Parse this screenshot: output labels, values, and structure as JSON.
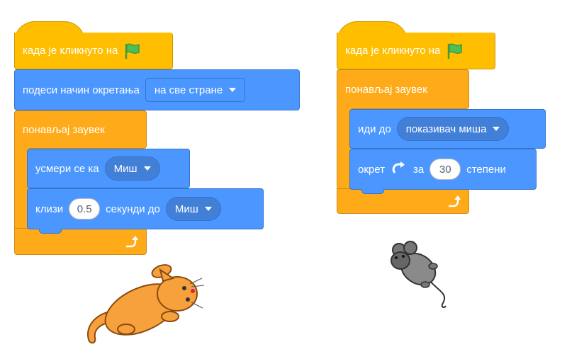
{
  "left_script": {
    "when_flag": "када је кликнуто на",
    "rotation_label": "подеси начин окретања",
    "rotation_value": "на све стране",
    "forever_label": "понављај заувек",
    "point_label": "усмери се ка",
    "point_value": "Миш",
    "glide_label": "клизи",
    "glide_seconds": "0.5",
    "glide_mid": "секунди до",
    "glide_target": "Миш"
  },
  "right_script": {
    "when_flag": "када је кликнуто на",
    "forever_label": "понављај заувек",
    "goto_label": "иди до",
    "goto_value": "показивач миша",
    "turn_label": "окрет",
    "turn_mid": "за",
    "turn_degrees": "30",
    "turn_unit": "степени"
  },
  "colors": {
    "events": "#FFBF00",
    "motion": "#4C97FF",
    "control": "#FFAB19"
  },
  "icons": [
    "green-flag-icon",
    "repeat-arrow-icon",
    "rotate-right-icon",
    "cat-sprite",
    "mouse-sprite"
  ]
}
